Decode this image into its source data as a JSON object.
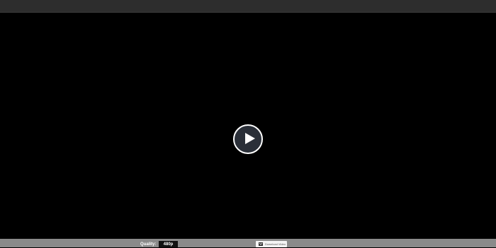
{
  "player": {
    "play_icon": "play-icon",
    "quality_label": "Quality:",
    "quality_value": "480p",
    "download_label": "Download Video",
    "download_icon": "download-icon"
  },
  "colors": {
    "topbar": "#2d2d2d",
    "video_background": "#000000",
    "controlbar": "#8a8a8a",
    "play_button_fill": "#2a2f38",
    "play_button_ring": "#ffffff"
  }
}
